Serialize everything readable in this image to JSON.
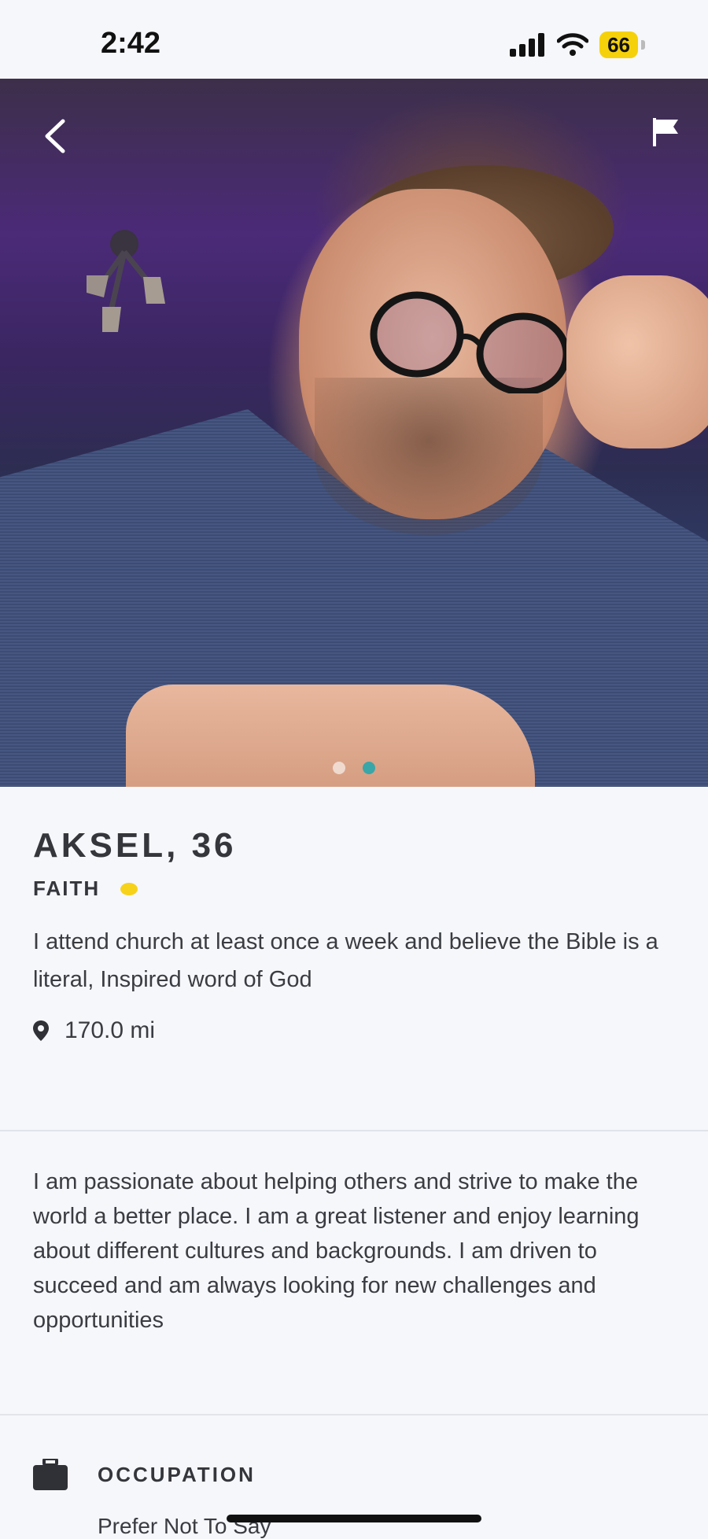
{
  "status_bar": {
    "time": "2:42",
    "battery": "66"
  },
  "profile": {
    "name_age": "AKSEL, 36",
    "faith_label": "FAITH",
    "faith_color": "#f7d21a",
    "faith_description": "I attend church at least once a week and believe the Bible is a literal, Inspired word of God",
    "distance": "170.0 mi",
    "photo_count": 2,
    "active_photo_index": 1
  },
  "bio": "I am passionate about helping others and strive to make the world a better place. I am a great listener and enjoy learning about different cultures and backgrounds. I am driven to succeed and am always looking for new challenges and opportunities",
  "occupation": {
    "label": "OCCUPATION",
    "value": "Prefer Not To Say"
  },
  "icons": [
    "back-chevron-icon",
    "flag-icon",
    "location-pin-icon",
    "briefcase-icon",
    "cellular-signal-icon",
    "wifi-icon",
    "battery-icon"
  ],
  "colors": {
    "accent_dot": "#3aa6a8",
    "background": "#f6f7fb"
  }
}
